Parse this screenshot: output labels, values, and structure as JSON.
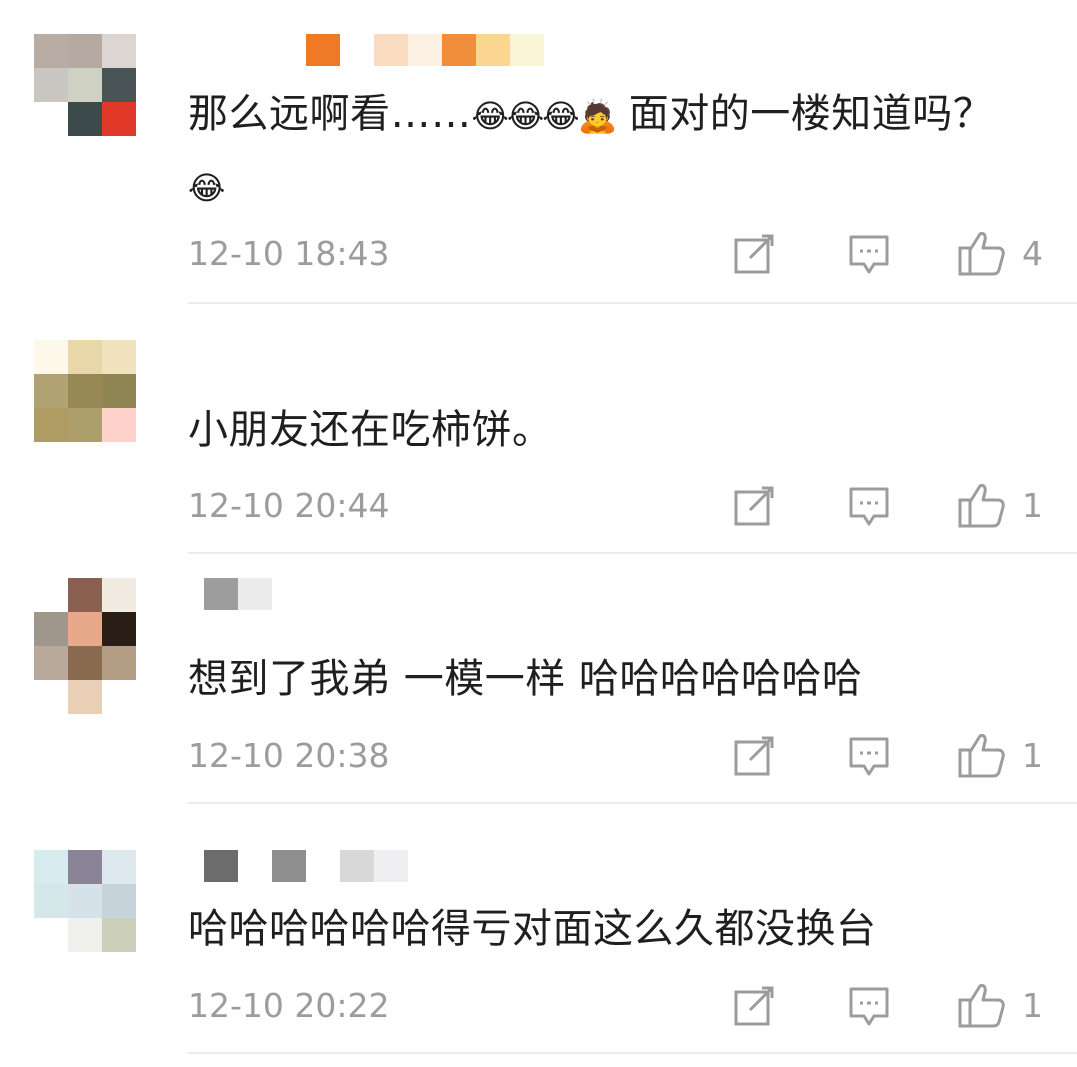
{
  "comments": [
    {
      "text": "那么远啊看……",
      "emojis": "😂😂😂🙇",
      "text_after": " 面对的一楼知道吗？",
      "emoji_end": "😂",
      "time": "12-10 18:43",
      "likes": "4"
    },
    {
      "text": "小朋友还在吃柿饼。",
      "time": "12-10 20:44",
      "likes": "1"
    },
    {
      "text": "想到了我弟  一模一样 哈哈哈哈哈哈哈",
      "time": "12-10 20:38",
      "likes": "1"
    },
    {
      "text": "哈哈哈哈哈哈得亏对面这么久都没换台",
      "time": "12-10 20:22",
      "likes": "1"
    }
  ],
  "icons": {
    "edit": "share-edit-icon",
    "reply": "reply-comment-icon",
    "like": "thumbs-up-icon"
  },
  "colors": {
    "text": "#1f1f1f",
    "meta": "#9c9c9c",
    "divider": "#ececec"
  }
}
